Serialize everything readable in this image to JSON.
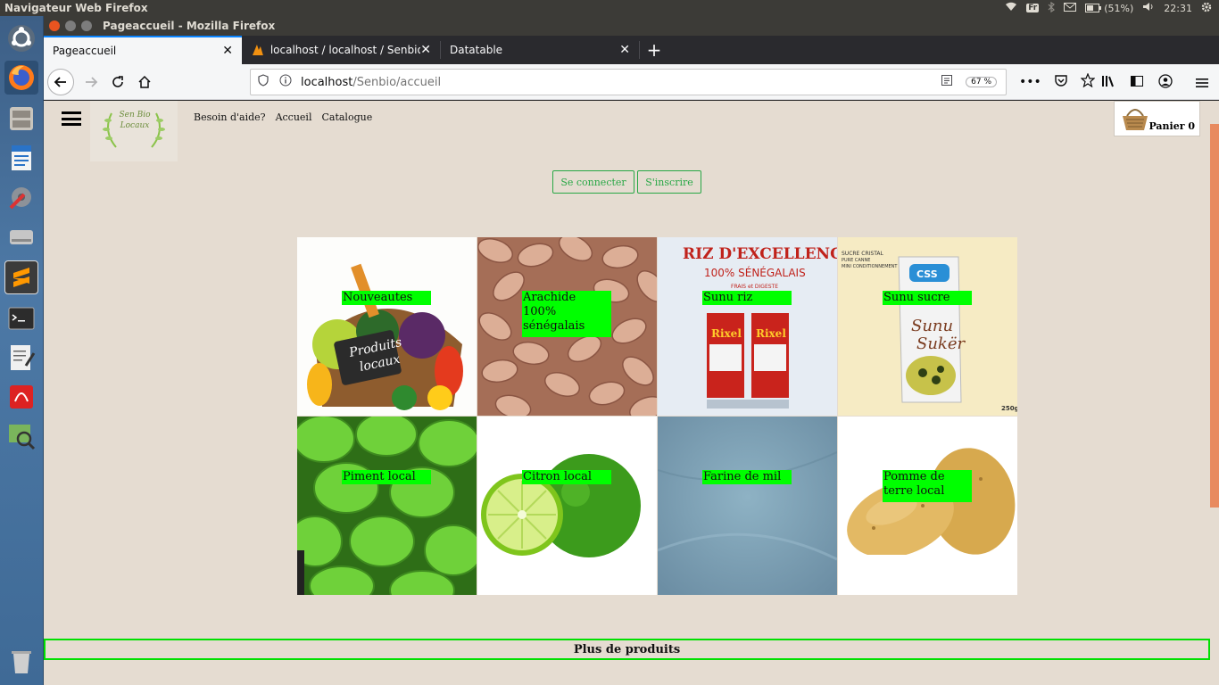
{
  "topbar": {
    "app_title": "Navigateur Web Firefox",
    "keyboard": "Fr",
    "battery": "(51%)",
    "clock": "22:31"
  },
  "window": {
    "title": "Pageaccueil - Mozilla Firefox"
  },
  "tabs": [
    {
      "label": "Pageaccueil",
      "active": true
    },
    {
      "label": "localhost / localhost / Senbio / U",
      "active": false
    },
    {
      "label": "Datatable",
      "active": false
    }
  ],
  "navbar": {
    "url_host": "localhost",
    "url_path": "/Senbio/accueil",
    "zoom": "67 %"
  },
  "site": {
    "logo_text": "Sen Bio Locaux",
    "nav_links": [
      "Besoin d'aide?",
      "Accueil",
      "Catalogue"
    ],
    "cart_label": "Panier 0",
    "login_label": "Se connecter",
    "signup_label": "S'inscrire",
    "products": [
      {
        "label": "Nouveautes",
        "image": "vegetable-basket"
      },
      {
        "label": "Arachide 100% sénégalais",
        "image": "peanuts"
      },
      {
        "label": "Sunu riz",
        "image": "rice-bags"
      },
      {
        "label": "Sunu sucre",
        "image": "sugar-pack"
      },
      {
        "label": "Piment local",
        "image": "green-peppers"
      },
      {
        "label": "Citron local",
        "image": "limes"
      },
      {
        "label": "Farine de mil",
        "image": "millet-flour"
      },
      {
        "label": "Pomme de terre local",
        "image": "potatoes"
      }
    ],
    "more_label": "Plus de produits"
  },
  "colors": {
    "page_bg": "#e5dcd1",
    "label_bg": "#00ff00",
    "button_accent": "#28a745",
    "more_border": "#00e000"
  }
}
